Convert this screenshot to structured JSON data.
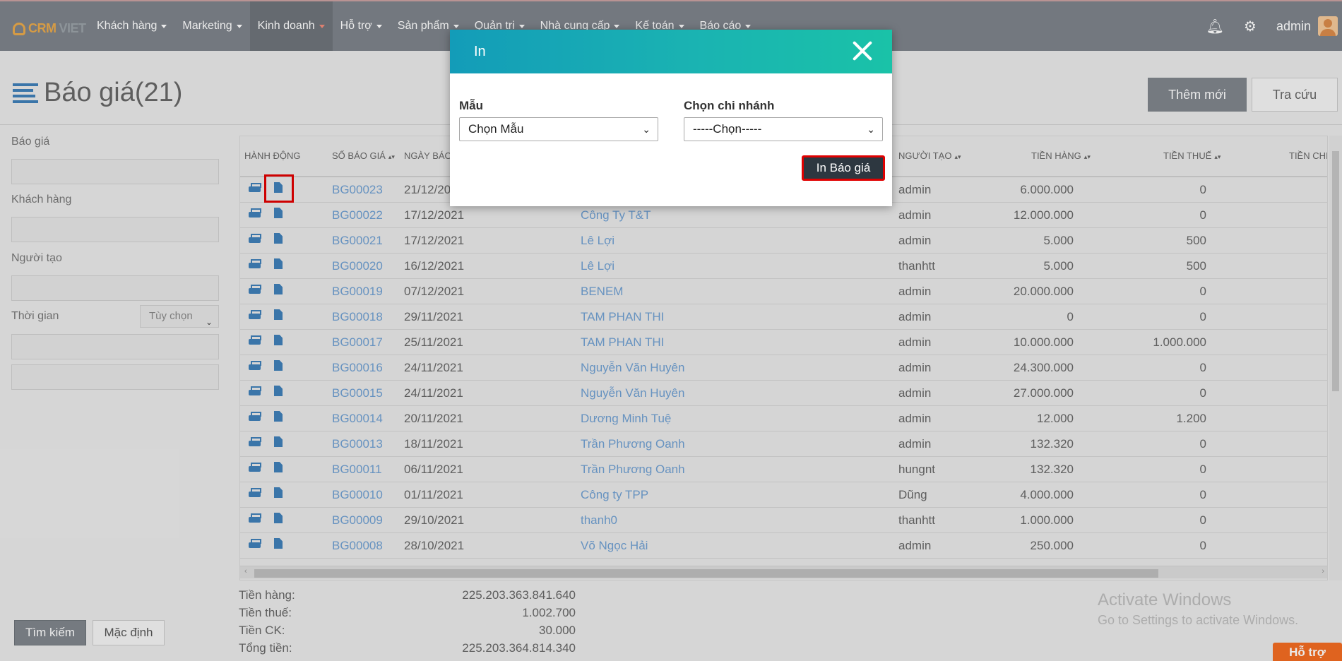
{
  "brand": {
    "crm": "CRM",
    "viet": "VIET"
  },
  "nav": {
    "items": [
      {
        "label": "Khách hàng",
        "active": false
      },
      {
        "label": "Marketing",
        "active": false
      },
      {
        "label": "Kinh doanh",
        "active": true
      },
      {
        "label": "Hỗ trợ",
        "active": false
      },
      {
        "label": "Sản phẩm",
        "active": false
      },
      {
        "label": "Quản trị",
        "active": false
      },
      {
        "label": "Nhà cung cấp",
        "active": false
      },
      {
        "label": "Kế toán",
        "active": false
      },
      {
        "label": "Báo cáo",
        "active": false
      }
    ],
    "user": "admin"
  },
  "page": {
    "title": "Báo giá(21)",
    "add_button": "Thêm mới",
    "lookup_button": "Tra cứu"
  },
  "filter": {
    "quote_label": "Báo giá",
    "customer_label": "Khách hàng",
    "creator_label": "Người tạo",
    "time_label": "Thời gian",
    "time_option": "Tùy chọn",
    "search_button": "Tìm kiếm",
    "default_button": "Mặc định"
  },
  "table": {
    "headers": {
      "action": "HÀNH ĐỘNG",
      "quote_no": "SỐ BÁO GIÁ",
      "quote_date": "NGÀY BÁO",
      "creator": "NGƯỜI TẠO",
      "amount": "TIỀN HÀNG",
      "tax": "TIỀN THUẾ",
      "more": "TIỀN CHI"
    },
    "rows": [
      {
        "code": "BG00023",
        "date": "21/12/20",
        "customer": "",
        "creator": "admin",
        "amount": "6.000.000",
        "tax": "0"
      },
      {
        "code": "BG00022",
        "date": "17/12/2021",
        "customer": "Công Ty T&T",
        "creator": "admin",
        "amount": "12.000.000",
        "tax": "0"
      },
      {
        "code": "BG00021",
        "date": "17/12/2021",
        "customer": "Lê Lợi",
        "creator": "admin",
        "amount": "5.000",
        "tax": "500"
      },
      {
        "code": "BG00020",
        "date": "16/12/2021",
        "customer": "Lê Lợi",
        "creator": "thanhtt",
        "amount": "5.000",
        "tax": "500"
      },
      {
        "code": "BG00019",
        "date": "07/12/2021",
        "customer": "BENEM",
        "creator": "admin",
        "amount": "20.000.000",
        "tax": "0"
      },
      {
        "code": "BG00018",
        "date": "29/11/2021",
        "customer": "TAM PHAN THI",
        "creator": "admin",
        "amount": "0",
        "tax": "0"
      },
      {
        "code": "BG00017",
        "date": "25/11/2021",
        "customer": "TAM PHAN THI",
        "creator": "admin",
        "amount": "10.000.000",
        "tax": "1.000.000"
      },
      {
        "code": "BG00016",
        "date": "24/11/2021",
        "customer": "Nguyễn Văn Huyên",
        "creator": "admin",
        "amount": "24.300.000",
        "tax": "0"
      },
      {
        "code": "BG00015",
        "date": "24/11/2021",
        "customer": "Nguyễn Văn Huyên",
        "creator": "admin",
        "amount": "27.000.000",
        "tax": "0"
      },
      {
        "code": "BG00014",
        "date": "20/11/2021",
        "customer": "Dương Minh Tuệ",
        "creator": "admin",
        "amount": "12.000",
        "tax": "1.200"
      },
      {
        "code": "BG00013",
        "date": "18/11/2021",
        "customer": "Trần Phương Oanh",
        "creator": "admin",
        "amount": "132.320",
        "tax": "0"
      },
      {
        "code": "BG00011",
        "date": "06/11/2021",
        "customer": "Trần Phương Oanh",
        "creator": "hungnt",
        "amount": "132.320",
        "tax": "0"
      },
      {
        "code": "BG00010",
        "date": "01/11/2021",
        "customer": "Công ty TPP",
        "creator": "Dũng",
        "amount": "4.000.000",
        "tax": "0"
      },
      {
        "code": "BG00009",
        "date": "29/10/2021",
        "customer": "thanh0",
        "creator": "thanhtt",
        "amount": "1.000.000",
        "tax": "0"
      },
      {
        "code": "BG00008",
        "date": "28/10/2021",
        "customer": "Võ Ngọc Hải",
        "creator": "admin",
        "amount": "250.000",
        "tax": "0"
      }
    ]
  },
  "totals": [
    {
      "label": "Tiền hàng:",
      "value": "225.203.363.841.640"
    },
    {
      "label": "Tiền thuế:",
      "value": "1.002.700"
    },
    {
      "label": "Tiền CK:",
      "value": "30.000"
    },
    {
      "label": "Tổng tiền:",
      "value": "225.203.364.814.340"
    }
  ],
  "watermark": {
    "line1": "Activate Windows",
    "line2": "Go to Settings to activate Windows."
  },
  "support": "Hỗ trợ",
  "modal": {
    "title": "In",
    "template_label": "Mẫu",
    "template_value": "Chọn Mẫu",
    "branch_label": "Chọn chi nhánh",
    "branch_value": "-----Chọn-----",
    "print_button": "In Báo giá"
  },
  "colors": {
    "nav_bg": "#7d838a",
    "link": "#6f9fd1",
    "icon_blue": "#3f7fb8",
    "modal_header": "#1ab3b2",
    "highlight": "#e00000",
    "support": "#f26c22"
  }
}
